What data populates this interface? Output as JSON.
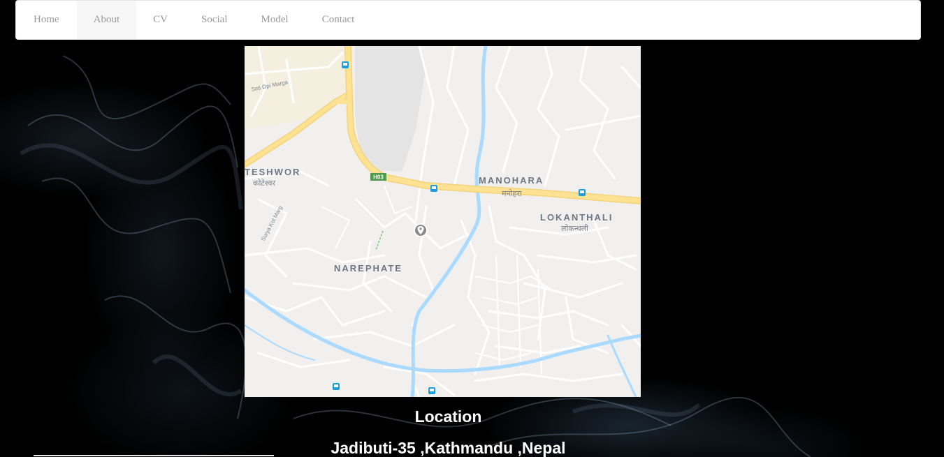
{
  "nav": {
    "items": [
      {
        "label": "Home"
      },
      {
        "label": "About"
      },
      {
        "label": "CV"
      },
      {
        "label": "Social"
      },
      {
        "label": "Model"
      },
      {
        "label": "Contact"
      }
    ],
    "active_item": "About"
  },
  "map": {
    "labels": {
      "teshwor": "TESHWOR",
      "teshwor_native": "कोटेश्वर",
      "manohara": "MANOHARA",
      "manohara_native": "मनोहरा",
      "lokanthali": "LOKANTHALI",
      "lokanthali_native": "लोकन्थली",
      "narephate": "NAREPHATE",
      "seti_opi": "Seti Opi Marga",
      "surya_kot": "Surya Kot Marg",
      "highway_shield": "H03"
    },
    "marker": "location-pin-icon",
    "colors": {
      "land": "#f1f0ee",
      "road": "#ffffff",
      "highway": "#fde293",
      "river": "#aadaff",
      "label": "#6b7786"
    }
  },
  "location": {
    "title": "Location",
    "address": "Jadibuti-35 ,Kathmandu ,Nepal"
  }
}
